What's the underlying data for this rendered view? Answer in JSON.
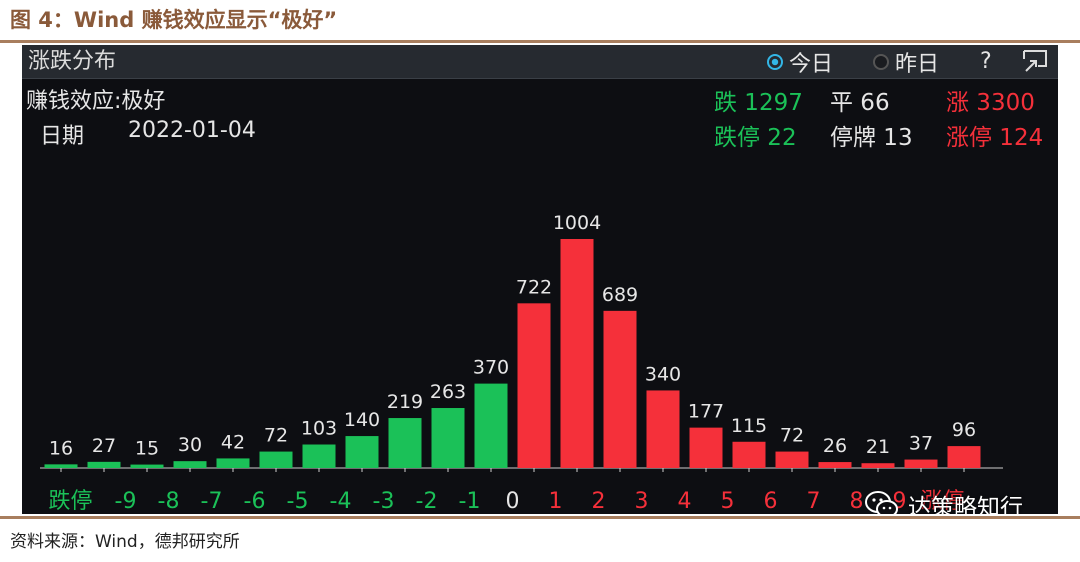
{
  "figure_title": "图 4：Wind 赚钱效应显示“极好”",
  "source_note": "资料来源：Wind，德邦研究所",
  "header": {
    "title": "涨跌分布",
    "today_label": "今日",
    "yesterday_label": "昨日",
    "help_label": "?",
    "selected": "today"
  },
  "info": {
    "effect_label": "赚钱效应:极好",
    "date_label": "日期",
    "date_value": "2022-01-04"
  },
  "stats": {
    "down": "跌 1297",
    "flat": "平 66",
    "up": "涨 3300",
    "limit_down": "跌停 22",
    "suspended": "停牌 13",
    "limit_up": "涨停 124"
  },
  "colors": {
    "down": "#1bc158",
    "up": "#f5303a",
    "neutral": "#e6e6e6"
  },
  "watermark": "达策略知行",
  "chart_data": {
    "type": "bar",
    "categories": [
      "跌停",
      "-9",
      "-8",
      "-7",
      "-6",
      "-5",
      "-4",
      "-3",
      "-2",
      "-1",
      "0",
      "1",
      "2",
      "3",
      "4",
      "5",
      "6",
      "7",
      "8",
      "9",
      "涨停"
    ],
    "values": [
      16,
      27,
      15,
      30,
      42,
      72,
      103,
      140,
      219,
      263,
      370,
      722,
      1004,
      689,
      340,
      177,
      115,
      72,
      26,
      21,
      37,
      96
    ],
    "bar_colors": [
      "down",
      "down",
      "down",
      "down",
      "down",
      "down",
      "down",
      "down",
      "down",
      "down",
      "down",
      "up",
      "up",
      "up",
      "up",
      "up",
      "up",
      "up",
      "up",
      "up",
      "up",
      "up"
    ],
    "label_colors": [
      "down",
      "down",
      "down",
      "down",
      "down",
      "down",
      "down",
      "down",
      "down",
      "down",
      "neutral",
      "up",
      "up",
      "up",
      "up",
      "up",
      "up",
      "up",
      "up",
      "up",
      "up"
    ],
    "ylim": [
      0,
      1004
    ]
  }
}
